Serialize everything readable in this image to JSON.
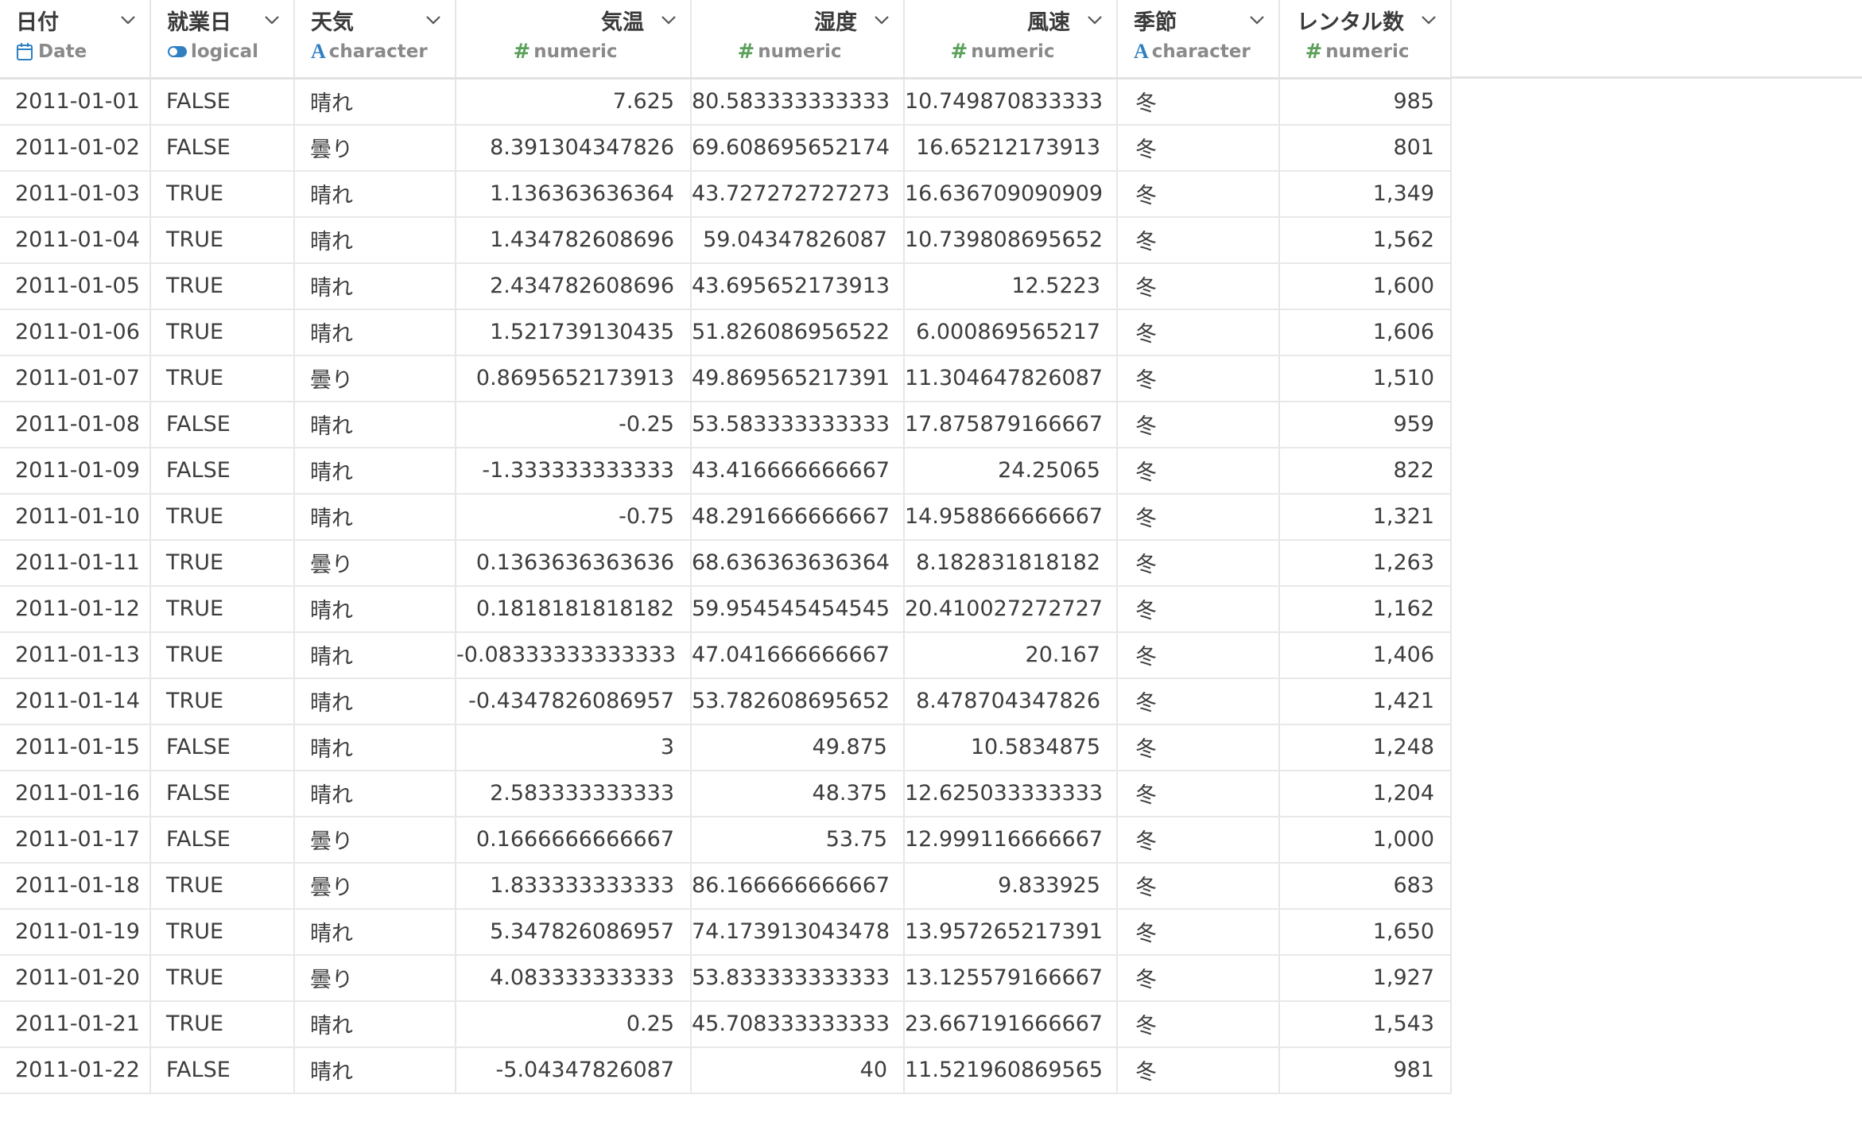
{
  "columns": [
    {
      "name": "日付",
      "type": "Date",
      "icon": "calendar-icon",
      "align": "left"
    },
    {
      "name": "就業日",
      "type": "logical",
      "icon": "toggle-icon",
      "align": "left"
    },
    {
      "name": "天気",
      "type": "character",
      "icon": "text-a-icon",
      "align": "left"
    },
    {
      "name": "気温",
      "type": "numeric",
      "icon": "hash-icon",
      "align": "right"
    },
    {
      "name": "湿度",
      "type": "numeric",
      "icon": "hash-icon",
      "align": "right"
    },
    {
      "name": "風速",
      "type": "numeric",
      "icon": "hash-icon",
      "align": "right"
    },
    {
      "name": "季節",
      "type": "character",
      "icon": "text-a-icon",
      "align": "left"
    },
    {
      "name": "レンタル数",
      "type": "numeric",
      "icon": "hash-icon",
      "align": "right"
    }
  ],
  "colors": {
    "numeric_icon": "#5aa05a",
    "character_icon": "#2f7fc1",
    "logical_icon": "#2f7fc1",
    "date_icon": "#2f7fc1"
  },
  "rows": [
    [
      "2011-01-01",
      "FALSE",
      "晴れ",
      "7.625",
      "80.583333333333",
      "10.749870833333",
      "冬",
      "985"
    ],
    [
      "2011-01-02",
      "FALSE",
      "曇り",
      "8.391304347826",
      "69.608695652174",
      "16.65212173913",
      "冬",
      "801"
    ],
    [
      "2011-01-03",
      "TRUE",
      "晴れ",
      "1.136363636364",
      "43.727272727273",
      "16.636709090909",
      "冬",
      "1,349"
    ],
    [
      "2011-01-04",
      "TRUE",
      "晴れ",
      "1.434782608696",
      "59.04347826087",
      "10.739808695652",
      "冬",
      "1,562"
    ],
    [
      "2011-01-05",
      "TRUE",
      "晴れ",
      "2.434782608696",
      "43.695652173913",
      "12.5223",
      "冬",
      "1,600"
    ],
    [
      "2011-01-06",
      "TRUE",
      "晴れ",
      "1.521739130435",
      "51.826086956522",
      "6.000869565217",
      "冬",
      "1,606"
    ],
    [
      "2011-01-07",
      "TRUE",
      "曇り",
      "0.8695652173913",
      "49.869565217391",
      "11.304647826087",
      "冬",
      "1,510"
    ],
    [
      "2011-01-08",
      "FALSE",
      "晴れ",
      "-0.25",
      "53.583333333333",
      "17.875879166667",
      "冬",
      "959"
    ],
    [
      "2011-01-09",
      "FALSE",
      "晴れ",
      "-1.333333333333",
      "43.416666666667",
      "24.25065",
      "冬",
      "822"
    ],
    [
      "2011-01-10",
      "TRUE",
      "晴れ",
      "-0.75",
      "48.291666666667",
      "14.958866666667",
      "冬",
      "1,321"
    ],
    [
      "2011-01-11",
      "TRUE",
      "曇り",
      "0.1363636363636",
      "68.636363636364",
      "8.182831818182",
      "冬",
      "1,263"
    ],
    [
      "2011-01-12",
      "TRUE",
      "晴れ",
      "0.1818181818182",
      "59.954545454545",
      "20.410027272727",
      "冬",
      "1,162"
    ],
    [
      "2011-01-13",
      "TRUE",
      "晴れ",
      "-0.08333333333333",
      "47.041666666667",
      "20.167",
      "冬",
      "1,406"
    ],
    [
      "2011-01-14",
      "TRUE",
      "晴れ",
      "-0.4347826086957",
      "53.782608695652",
      "8.478704347826",
      "冬",
      "1,421"
    ],
    [
      "2011-01-15",
      "FALSE",
      "晴れ",
      "3",
      "49.875",
      "10.5834875",
      "冬",
      "1,248"
    ],
    [
      "2011-01-16",
      "FALSE",
      "晴れ",
      "2.583333333333",
      "48.375",
      "12.625033333333",
      "冬",
      "1,204"
    ],
    [
      "2011-01-17",
      "FALSE",
      "曇り",
      "0.1666666666667",
      "53.75",
      "12.999116666667",
      "冬",
      "1,000"
    ],
    [
      "2011-01-18",
      "TRUE",
      "曇り",
      "1.833333333333",
      "86.166666666667",
      "9.833925",
      "冬",
      "683"
    ],
    [
      "2011-01-19",
      "TRUE",
      "晴れ",
      "5.347826086957",
      "74.173913043478",
      "13.957265217391",
      "冬",
      "1,650"
    ],
    [
      "2011-01-20",
      "TRUE",
      "曇り",
      "4.083333333333",
      "53.833333333333",
      "13.125579166667",
      "冬",
      "1,927"
    ],
    [
      "2011-01-21",
      "TRUE",
      "晴れ",
      "0.25",
      "45.708333333333",
      "23.667191666667",
      "冬",
      "1,543"
    ],
    [
      "2011-01-22",
      "FALSE",
      "晴れ",
      "-5.04347826087",
      "40",
      "11.521960869565",
      "冬",
      "981"
    ]
  ]
}
